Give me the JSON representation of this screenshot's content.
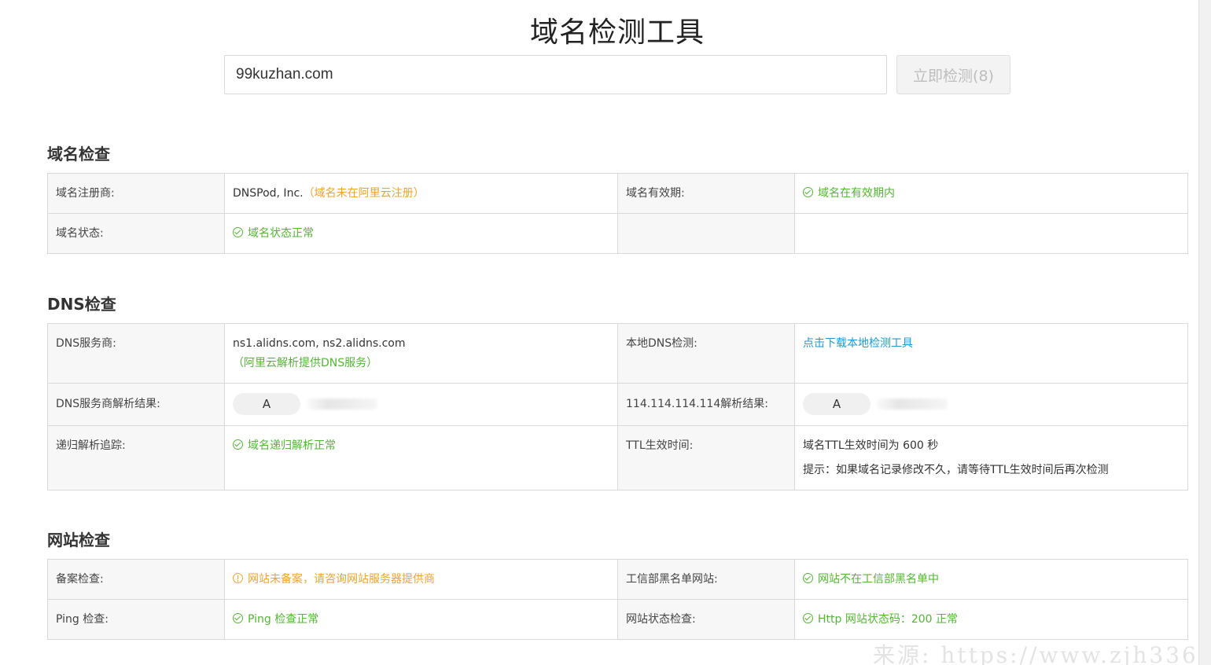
{
  "header": {
    "title": "域名检测工具",
    "search_value": "99kuzhan.com",
    "check_button_label": "立即检测(8)"
  },
  "domain_section": {
    "title": "域名检查",
    "registrar_label": "域名注册商:",
    "registrar_value": "DNSPod, Inc.",
    "registrar_note": "（域名未在阿里云注册）",
    "validity_label": "域名有效期:",
    "validity_value": "域名在有效期内",
    "status_label": "域名状态:",
    "status_value": "域名状态正常"
  },
  "dns_section": {
    "title": "DNS检查",
    "provider_label": "DNS服务商:",
    "provider_value": "ns1.alidns.com, ns2.alidns.com",
    "provider_note": "（阿里云解析提供DNS服务）",
    "local_dns_label": "本地DNS检测:",
    "local_dns_link": "点击下载本地检测工具",
    "provider_result_label": "DNS服务商解析结果:",
    "provider_result_record": "A",
    "public_result_label": "114.114.114.114解析结果:",
    "public_result_record": "A",
    "recursive_label": "递归解析追踪:",
    "recursive_value": "域名递归解析正常",
    "ttl_label": "TTL生效时间:",
    "ttl_value": "域名TTL生效时间为 600 秒",
    "ttl_tip": "提示：如果域名记录修改不久，请等待TTL生效时间后再次检测"
  },
  "website_section": {
    "title": "网站检查",
    "icp_label": "备案检查:",
    "icp_value": "网站未备案，请咨询网站服务器提供商",
    "blacklist_label": "工信部黑名单网站:",
    "blacklist_value": "网站不在工信部黑名单中",
    "ping_label": "Ping 检查:",
    "ping_value": "Ping 检查正常",
    "http_label": "网站状态检查:",
    "http_value": "Http 网站状态码：200 正常"
  },
  "watermark": "来源: https://www.zjh336.c",
  "colors": {
    "ok": "#52b733",
    "warn": "#f0a32c",
    "link": "#1a9cd4"
  },
  "icons": {
    "ok": "check-circle-icon",
    "warn": "warning-circle-icon"
  }
}
